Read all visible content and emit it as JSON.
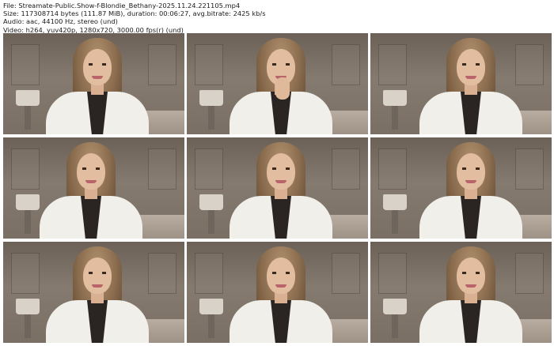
{
  "header": {
    "file": "File: Streamate-Public.Show-f-Blondie_Bethany-2025.11.24.221105.mp4",
    "size": "Size: 117308714 bytes (111.87 MiB), duration: 00:06:27, avg.bitrate: 2425 kb/s",
    "audio": "Audio: aac, 44100 Hz, stereo (und)",
    "video": "Video: h264, yuv420p, 1280x720, 3000.00 fps(r) (und)"
  },
  "thumbnails": [
    {
      "name": "thumbnail-1"
    },
    {
      "name": "thumbnail-2"
    },
    {
      "name": "thumbnail-3"
    },
    {
      "name": "thumbnail-4"
    },
    {
      "name": "thumbnail-5"
    },
    {
      "name": "thumbnail-6"
    },
    {
      "name": "thumbnail-7"
    },
    {
      "name": "thumbnail-8"
    },
    {
      "name": "thumbnail-9"
    }
  ]
}
